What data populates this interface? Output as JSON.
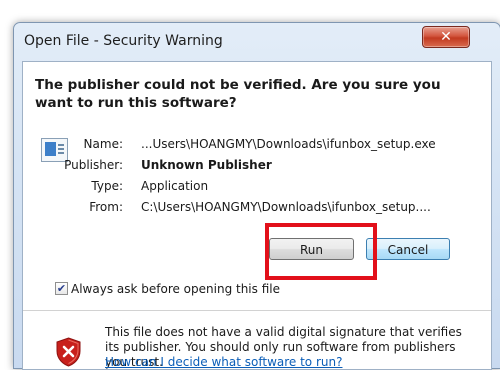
{
  "window": {
    "title": "Open File - Security Warning",
    "close_glyph": "✕"
  },
  "heading": "The publisher could not be verified.  Are you sure you want to run this software?",
  "details": [
    {
      "label": "Name:",
      "value": "...Users\\HOANGMY\\Downloads\\ifunbox_setup.exe",
      "bold": false
    },
    {
      "label": "Publisher:",
      "value": "Unknown Publisher",
      "bold": true
    },
    {
      "label": "Type:",
      "value": "Application",
      "bold": false
    },
    {
      "label": "From:",
      "value": "C:\\Users\\HOANGMY\\Downloads\\ifunbox_setup....",
      "bold": false
    }
  ],
  "buttons": {
    "run": "Run",
    "cancel": "Cancel"
  },
  "checkbox": {
    "label": "Always ask before opening this file",
    "checked": true,
    "glyph": "✔"
  },
  "warning": {
    "text": "This file does not have a valid digital signature that verifies its publisher.  You should only run software from publishers you trust.",
    "link": "How can I decide what software to run?"
  },
  "colors": {
    "highlight": "#e2101a",
    "link": "#0b5eb8",
    "shield_red": "#c8201c"
  },
  "icons": {
    "file": "application-file-icon",
    "shield": "security-shield-error-icon",
    "close": "close-icon",
    "checkmark": "checkmark-icon"
  }
}
